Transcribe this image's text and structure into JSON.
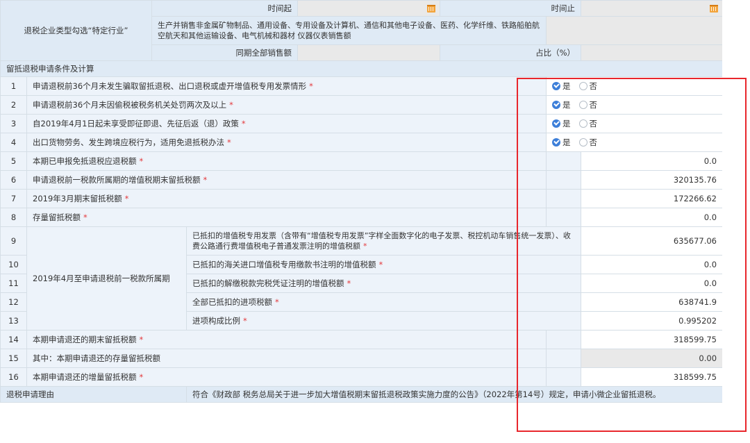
{
  "header": {
    "category_label": "退税企业类型勾选“特定行业”",
    "time_start_label": "时间起",
    "time_end_label": "时间止",
    "industry_text": "生产并销售非金属矿物制品、通用设备、专用设备及计算机、通信和其他电子设备、医药、化学纤维、铁路船舶航空航天和其他运输设备、电气机械和器材 仪器仪表销售额",
    "total_sales_label": "同期全部销售额",
    "ratio_label": "占比（%）"
  },
  "section_title": "留抵退税申请条件及计算",
  "radio_labels": {
    "yes": "是",
    "no": "否"
  },
  "sub_group_label": "2019年4月至申请退税前一税款所属期",
  "rows": [
    {
      "no": "1",
      "label": "申请退税前36个月未发生骗取留抵退税、出口退税或虚开增值税专用发票情形",
      "required": "*",
      "yes_checked": true
    },
    {
      "no": "2",
      "label": "申请退税前36个月未因偷税被税务机关处罚两次及以上",
      "required": "*",
      "yes_checked": true
    },
    {
      "no": "3",
      "label": "自2019年4月1日起未享受即征即退、先征后返（退）政策",
      "required": "*",
      "yes_checked": true
    },
    {
      "no": "4",
      "label": "出口货物劳务、发生跨境应税行为，适用免退抵税办法",
      "required": "*",
      "yes_checked": true
    },
    {
      "no": "5",
      "label": "本期已申报免抵退税应退税额",
      "required": "*",
      "value": "0.0"
    },
    {
      "no": "6",
      "label": "申请退税前一税款所属期的增值税期末留抵税额",
      "required": "*",
      "value": "320135.76"
    },
    {
      "no": "7",
      "label": "2019年3月期末留抵税额",
      "required": "*",
      "value": "172266.62"
    },
    {
      "no": "8",
      "label": "存量留抵税额",
      "required": "*",
      "value": "0.0"
    },
    {
      "no": "9",
      "label": "已抵扣的增值税专用发票（含带有“增值税专用发票”字样全面数字化的电子发票、税控机动车销售统一发票）、收费公路通行费增值税电子普通发票注明的增值税额",
      "required": "*",
      "value": "635677.06"
    },
    {
      "no": "10",
      "label": "已抵扣的海关进口增值税专用缴款书注明的增值税额",
      "required": "*",
      "value": "0.0"
    },
    {
      "no": "11",
      "label": "已抵扣的解缴税款完税凭证注明的增值税额",
      "required": "*",
      "value": "0.0"
    },
    {
      "no": "12",
      "label": "全部已抵扣的进项税额",
      "required": "*",
      "value": "638741.9"
    },
    {
      "no": "13",
      "label": "进项构成比例",
      "required": "*",
      "value": "0.995202"
    },
    {
      "no": "14",
      "label": "本期申请退还的期末留抵税额",
      "required": "*",
      "value": "318599.75"
    },
    {
      "no": "15",
      "label": "其中：本期申请退还的存量留抵税额",
      "value": "0.00"
    },
    {
      "no": "16",
      "label": "本期申请退还的增量留抵税额",
      "required": "*",
      "value": "318599.75"
    }
  ],
  "reason": {
    "label": "退税申请理由",
    "text": "符合《财政部 税务总局关于进一步加大增值税期末留抵退税政策实施力度的公告》（2022年第14号）规定，申请小微企业留抵退税。"
  },
  "colors": {
    "header_bg": "#dfeaf5",
    "label_bg": "#edf3fa",
    "readonly_bg": "#e9e9e9",
    "radio_checked": "#3d7fd9",
    "highlight_border": "#e8262c",
    "required_mark": "#e4393c",
    "calendar_icon": "#f3a43b"
  }
}
